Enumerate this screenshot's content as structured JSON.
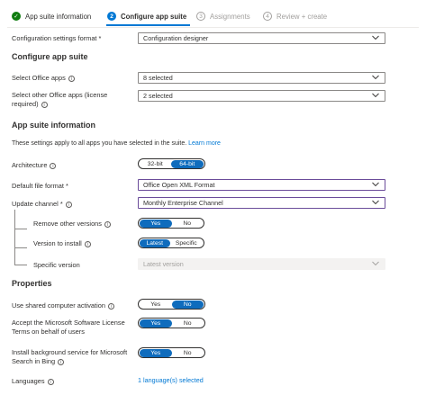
{
  "wizard": {
    "steps": [
      {
        "number": "✓",
        "label": "App suite information",
        "state": "done"
      },
      {
        "number": "2",
        "label": "Configure app suite",
        "state": "current"
      },
      {
        "number": "3",
        "label": "Assignments",
        "state": "todo"
      },
      {
        "number": "4",
        "label": "Review + create",
        "state": "todo"
      }
    ]
  },
  "config_format": {
    "label": "Configuration settings format *",
    "value": "Configuration designer"
  },
  "configure_section": {
    "title": "Configure app suite",
    "office_apps_label": "Select Office apps",
    "office_apps_value": "8 selected",
    "other_apps_label_line1": "Select other Office apps (license",
    "other_apps_label_line2": "required)",
    "other_apps_value": "2 selected"
  },
  "info_section": {
    "title": "App suite information",
    "description": "These settings apply to all apps you have selected in the suite.",
    "learn_more": "Learn more",
    "architecture_label": "Architecture",
    "architecture_options": [
      "32-bit",
      "64-bit"
    ],
    "architecture_selected": "64-bit",
    "file_format_label": "Default file format *",
    "file_format_value": "Office Open XML Format",
    "update_channel_label": "Update channel *",
    "update_channel_value": "Monthly Enterprise Channel",
    "remove_versions_label": "Remove other versions",
    "remove_versions_options": [
      "Yes",
      "No"
    ],
    "remove_versions_selected": "Yes",
    "version_install_label": "Version to install",
    "version_install_options": [
      "Latest",
      "Specific"
    ],
    "version_install_selected": "Latest",
    "specific_version_label": "Specific version",
    "specific_version_value": "Latest version"
  },
  "properties": {
    "title": "Properties",
    "shared_activation_label": "Use shared computer activation",
    "shared_activation_options": [
      "Yes",
      "No"
    ],
    "shared_activation_selected": "No",
    "accept_license_label_line1": "Accept the Microsoft Software License",
    "accept_license_label_line2": "Terms on behalf of users",
    "accept_license_options": [
      "Yes",
      "No"
    ],
    "accept_license_selected": "Yes",
    "bing_label_line1": "Install background service for Microsoft",
    "bing_label_line2": "Search in Bing",
    "bing_options": [
      "Yes",
      "No"
    ],
    "bing_selected": "Yes",
    "languages_label": "Languages",
    "languages_value": "1 language(s) selected"
  },
  "colors": {
    "accent": "#0078d4",
    "toggle_on": "#0f6cbd",
    "done": "#107c10",
    "purple_border": "#6b4c9a"
  }
}
